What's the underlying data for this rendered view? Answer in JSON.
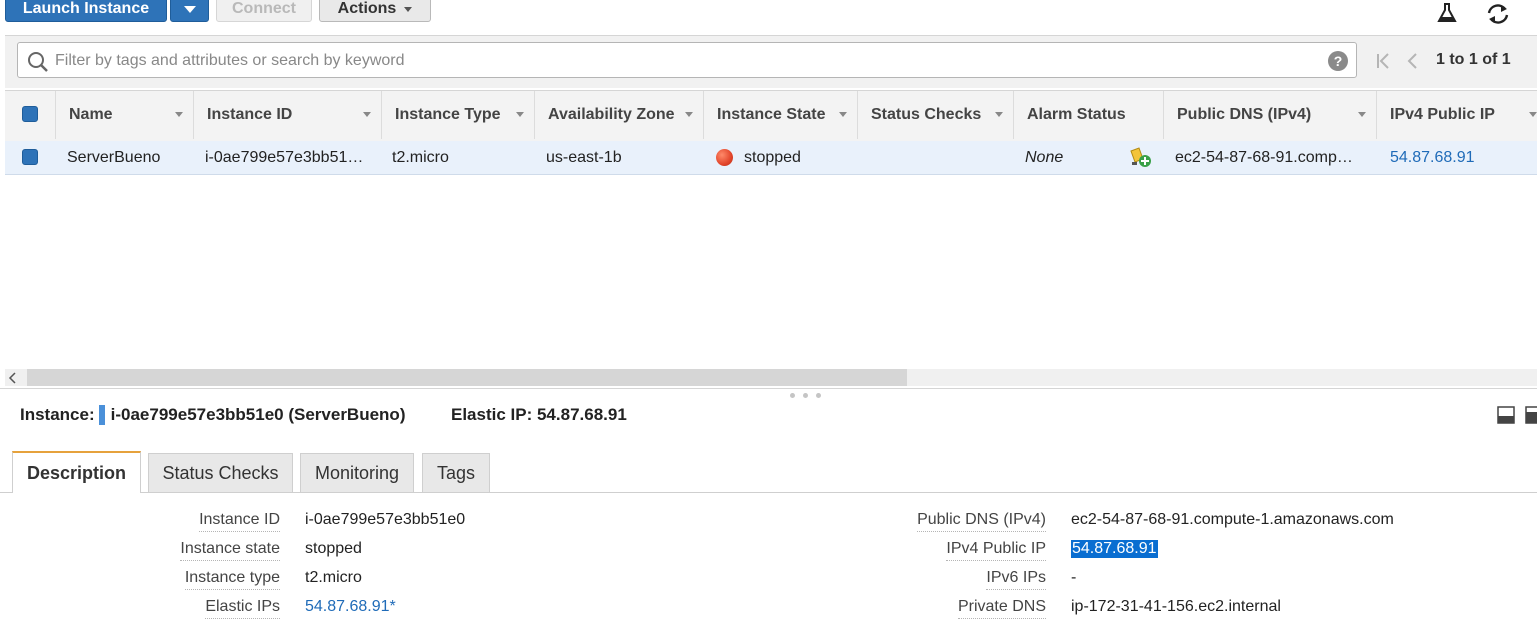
{
  "toolbar": {
    "launch_label": "Launch Instance",
    "connect_label": "Connect",
    "actions_label": "Actions"
  },
  "search": {
    "placeholder": "Filter by tags and attributes or search by keyword",
    "pagination": "1 to 1 of 1"
  },
  "table": {
    "columns": [
      "Name",
      "Instance ID",
      "Instance Type",
      "Availability Zone",
      "Instance State",
      "Status Checks",
      "Alarm Status",
      "Public DNS (IPv4)",
      "IPv4 Public IP"
    ],
    "rows": [
      {
        "name": "ServerBueno",
        "instance_id": "i-0ae799e57e3bb51…",
        "instance_type": "t2.micro",
        "availability_zone": "us-east-1b",
        "instance_state": "stopped",
        "status_checks": "",
        "alarm_status": "None",
        "public_dns": "ec2-54-87-68-91.comp…",
        "ipv4_public_ip": "54.87.68.91"
      }
    ]
  },
  "details": {
    "instance_label": "Instance:",
    "instance_value": "i-0ae799e57e3bb51e0 (ServerBueno)",
    "elastic_ip_header": "Elastic IP: 54.87.68.91",
    "tabs": [
      "Description",
      "Status Checks",
      "Monitoring",
      "Tags"
    ],
    "left": [
      {
        "label": "Instance ID",
        "value": "i-0ae799e57e3bb51e0"
      },
      {
        "label": "Instance state",
        "value": "stopped"
      },
      {
        "label": "Instance type",
        "value": "t2.micro"
      },
      {
        "label": "Elastic IPs",
        "value": "54.87.68.91*"
      }
    ],
    "right": [
      {
        "label": "Public DNS (IPv4)",
        "value": "ec2-54-87-68-91.compute-1.amazonaws.com"
      },
      {
        "label": "IPv4 Public IP",
        "value": "54.87.68.91"
      },
      {
        "label": "IPv6 IPs",
        "value": "-"
      },
      {
        "label": "Private DNS",
        "value": "ip-172-31-41-156.ec2.internal"
      }
    ]
  },
  "colors": {
    "primary": "#2e73b8",
    "stopped": "#e2452b",
    "link": "#1f6bb8",
    "selection": "#0a6ed1"
  }
}
